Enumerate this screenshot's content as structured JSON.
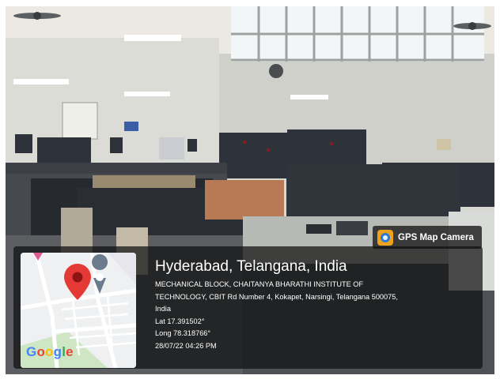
{
  "badge": {
    "label": "GPS Map Camera",
    "icon": "gps-map-camera-icon"
  },
  "map": {
    "provider_logo": "Google",
    "pin_icon": "location-pin-icon",
    "colors": {
      "pin": "#e53935",
      "road": "#ffffff",
      "green_area": "#cfe6c4",
      "background": "#eef0f2"
    }
  },
  "location": {
    "title": "Hyderabad, Telangana, India",
    "address_line_1": "MECHANICAL BLOCK, CHAITANYA BHARATHI INSTITUTE OF",
    "address_line_2": "TECHNOLOGY, CBIT Rd Number 4, Kokapet, Narsingi, Telangana 500075,",
    "address_line_3": "India",
    "latitude": "Lat 17.391502°",
    "longitude": "Long 78.318766°",
    "timestamp": "28/07/22 04:26 PM"
  },
  "scene": {
    "description_icon": "laboratory-photo",
    "colors": {
      "wall": "#d6d6d0",
      "ceiling": "#eceae3",
      "panels": "#2b3038",
      "floor": "#55575a"
    }
  }
}
